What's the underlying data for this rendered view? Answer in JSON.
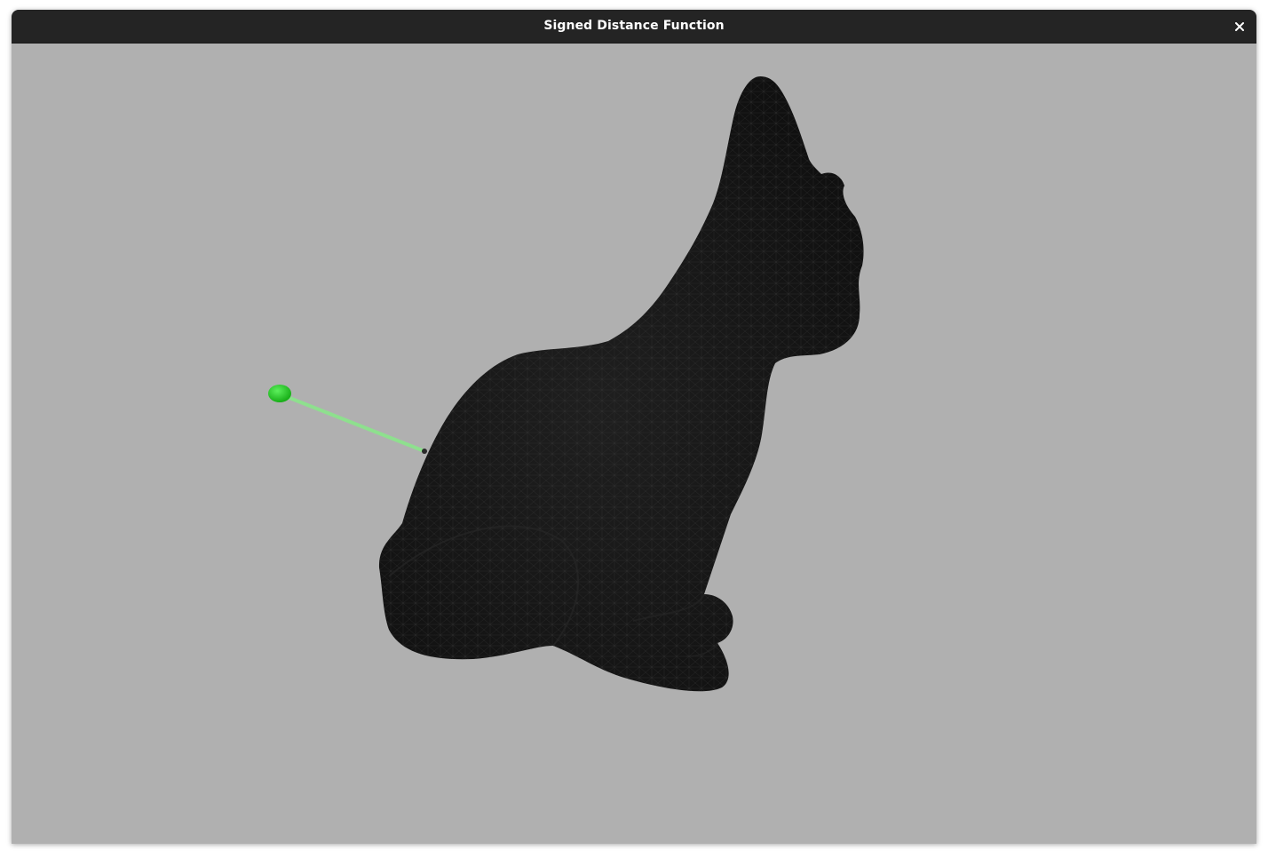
{
  "window": {
    "title": "Signed Distance Function",
    "close_icon": "close-icon"
  },
  "viewport": {
    "background_color": "#b0b0b0",
    "mesh_color": "#141414",
    "wireframe_color": "#3a3a3a",
    "query_point_color": "#1ec81e",
    "distance_line_color": "#8ee08e",
    "mesh_object": "cat-mesh",
    "query_point_icon": "green-sphere-icon"
  }
}
